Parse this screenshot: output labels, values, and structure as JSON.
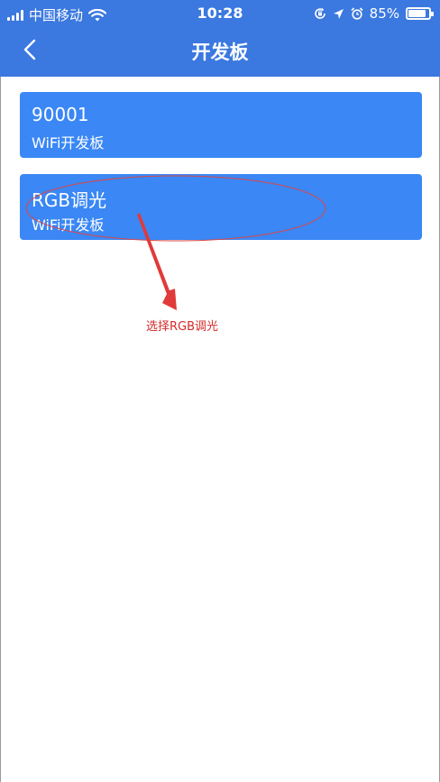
{
  "status_bar": {
    "carrier": "中国移动",
    "time": "10:28",
    "battery": "85%",
    "battery_level": 0.85,
    "icons": [
      "signal-icon",
      "wifi-icon",
      "rotation-lock-icon",
      "location-icon",
      "alarm-icon",
      "battery-icon"
    ]
  },
  "nav": {
    "title": "开发板",
    "back_icon": "chevron-left-icon"
  },
  "boards": [
    {
      "name": "90001",
      "type": "WiFi开发板"
    },
    {
      "name": "RGB调光",
      "type": "WiFi开发板"
    }
  ],
  "annotation": {
    "text": "选择RGB调光",
    "color": "#d42a2a"
  },
  "colors": {
    "header": "#3b78e0",
    "card": "#3a87f5"
  }
}
